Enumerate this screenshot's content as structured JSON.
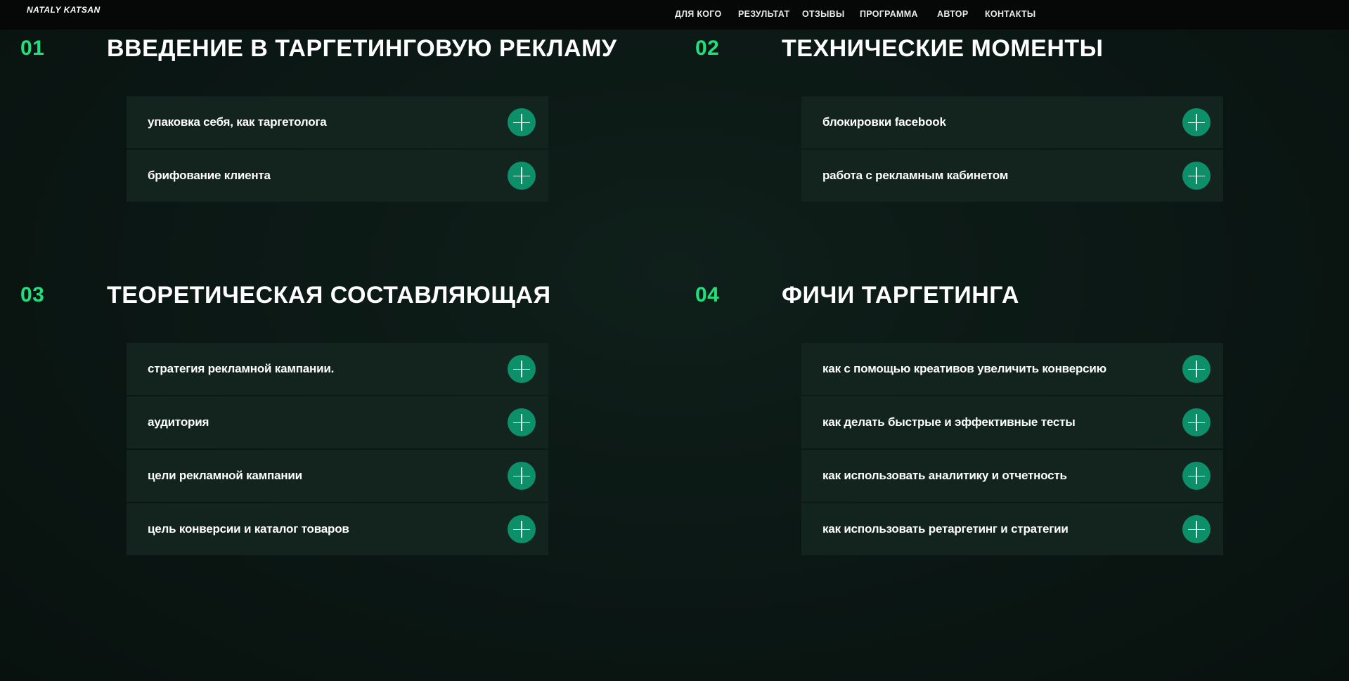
{
  "header": {
    "logo": "NATALY KATSAN",
    "nav": [
      {
        "label": "ДЛЯ КОГО"
      },
      {
        "label": "РЕЗУЛЬТАТ"
      },
      {
        "label": "ОТЗЫВЫ"
      },
      {
        "label": "ПРОГРАММА"
      },
      {
        "label": "АВТОР"
      },
      {
        "label": "КОНТАКТЫ"
      }
    ]
  },
  "sections": [
    {
      "number": "01",
      "title": "ВВЕДЕНИЕ В ТАРГЕТИНГОВУЮ РЕКЛАМУ",
      "items": [
        {
          "label": "упаковка себя, как таргетолога"
        },
        {
          "label": "брифование клиента"
        }
      ]
    },
    {
      "number": "02",
      "title": "ТЕХНИЧЕСКИЕ МОМЕНТЫ",
      "items": [
        {
          "label": "блокировки facebook"
        },
        {
          "label": "работа с рекламным кабинетом"
        }
      ]
    },
    {
      "number": "03",
      "title": "ТЕОРЕТИЧЕСКАЯ СОСТАВЛЯЮЩАЯ",
      "items": [
        {
          "label": "стратегия рекламной кампании."
        },
        {
          "label": "аудитория"
        },
        {
          "label": "цели рекламной кампании"
        },
        {
          "label": "цель конверсии и каталог товаров"
        }
      ]
    },
    {
      "number": "04",
      "title": "ФИЧИ ТАРГЕТИНГА",
      "items": [
        {
          "label": "как с помощью креативов увеличить конверсию"
        },
        {
          "label": "как делать быстрые и эффективные тесты"
        },
        {
          "label": "как использовать аналитику и отчетность"
        },
        {
          "label": "как использовать ретаргетинг и стратегии"
        }
      ]
    }
  ],
  "colors": {
    "accent": "#1fe07a",
    "button": "#0d8f6a",
    "card": "#13241f",
    "background": "#0b1613"
  },
  "icons": {
    "expand": "plus-icon"
  }
}
